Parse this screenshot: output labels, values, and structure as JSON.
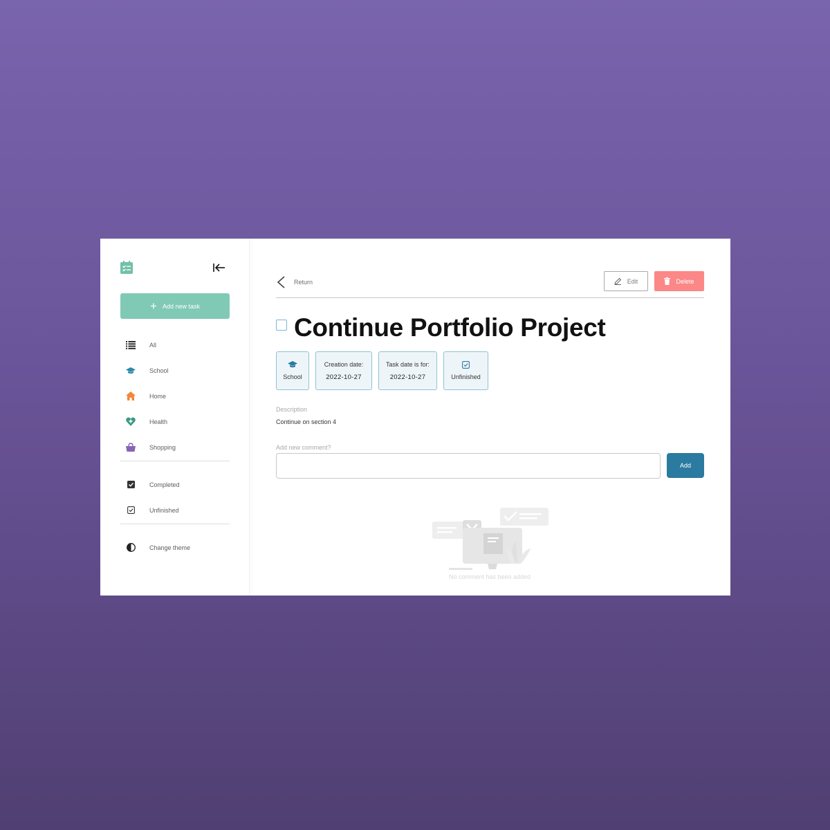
{
  "sidebar": {
    "add_task_label": "Add new task",
    "categories": [
      {
        "label": "All",
        "icon": "list-icon",
        "color": "#2d2d2d"
      },
      {
        "label": "School",
        "icon": "graduation-cap-icon",
        "color": "#2b8aa8"
      },
      {
        "label": "Home",
        "icon": "house-icon",
        "color": "#f0883e"
      },
      {
        "label": "Health",
        "icon": "heart-plus-icon",
        "color": "#3a9a86"
      },
      {
        "label": "Shopping",
        "icon": "basket-icon",
        "color": "#8a63b8"
      }
    ],
    "filters": [
      {
        "label": "Completed",
        "icon": "checked-box-icon"
      },
      {
        "label": "Unfinished",
        "icon": "unchecked-box-icon"
      }
    ],
    "theme_label": "Change theme"
  },
  "topbar": {
    "return_label": "Return",
    "edit_label": "Edit",
    "delete_label": "Delete"
  },
  "task": {
    "title": "Continue Portfolio Project",
    "category": "School",
    "creation_label": "Creation date:",
    "creation_date": "2022-10-27",
    "due_label": "Task date is for:",
    "due_date": "2022-10-27",
    "status": "Unfinished",
    "description_label": "Description",
    "description": "Continue on section 4"
  },
  "comments": {
    "label": "Add new comment?",
    "input_value": "",
    "add_label": "Add",
    "empty_text": "No comment has been added"
  },
  "colors": {
    "accent_green": "#80c9b5",
    "primary_blue": "#2b7aa0",
    "danger": "#fb8787",
    "chip_bg": "#eef5f9"
  }
}
